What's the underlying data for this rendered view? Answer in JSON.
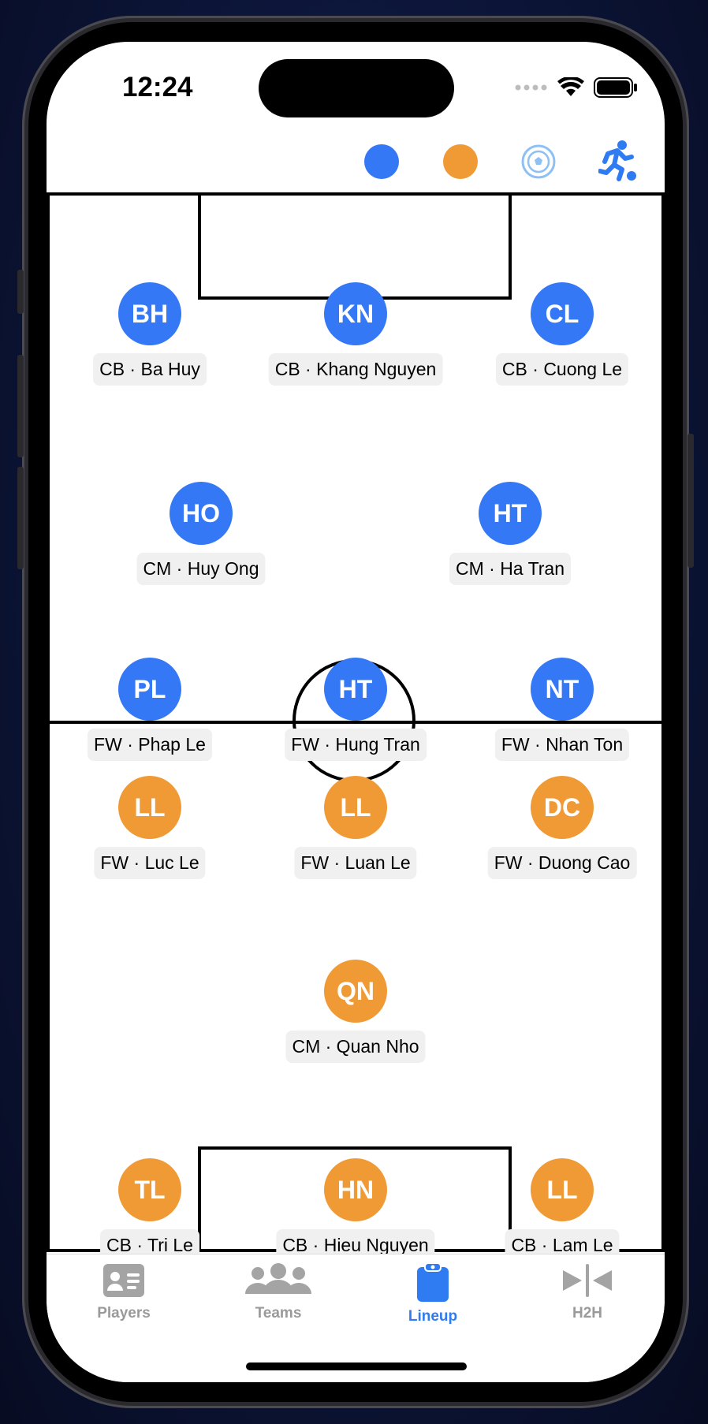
{
  "status": {
    "time": "12:24"
  },
  "toolbar": {
    "team_a_color": "#3478f6",
    "team_b_color": "#f09a36",
    "icons": [
      "team-a-dot",
      "team-b-dot",
      "soccer-ball-icon",
      "running-player-icon"
    ]
  },
  "colors": {
    "team_a": "#3478f6",
    "team_b": "#f09a36",
    "accent": "#2f7bf2"
  },
  "team_a": {
    "defenders": [
      {
        "initials": "BH",
        "label": "CB · Ba Huy"
      },
      {
        "initials": "KN",
        "label": "CB · Khang Nguyen"
      },
      {
        "initials": "CL",
        "label": "CB · Cuong Le"
      }
    ],
    "midfielders": [
      {
        "initials": "HO",
        "label": "CM · Huy Ong"
      },
      {
        "initials": "HT",
        "label": "CM · Ha Tran"
      }
    ],
    "forwards": [
      {
        "initials": "PL",
        "label": "FW · Phap Le"
      },
      {
        "initials": "HT",
        "label": "FW · Hung Tran"
      },
      {
        "initials": "NT",
        "label": "FW · Nhan Ton"
      }
    ]
  },
  "team_b": {
    "forwards": [
      {
        "initials": "LL",
        "label": "FW · Luc Le"
      },
      {
        "initials": "LL",
        "label": "FW · Luan Le"
      },
      {
        "initials": "DC",
        "label": "FW · Duong Cao"
      }
    ],
    "midfielders": [
      {
        "initials": "QN",
        "label": "CM · Quan Nho"
      }
    ],
    "defenders": [
      {
        "initials": "TL",
        "label": "CB · Tri Le"
      },
      {
        "initials": "HN",
        "label": "CB · Hieu Nguyen"
      },
      {
        "initials": "LL",
        "label": "CB · Lam Le"
      }
    ]
  },
  "tabs": [
    {
      "label": "Players",
      "icon": "person-card-icon",
      "active": false
    },
    {
      "label": "Teams",
      "icon": "people-group-icon",
      "active": false
    },
    {
      "label": "Lineup",
      "icon": "clipboard-icon",
      "active": true
    },
    {
      "label": "H2H",
      "icon": "head-to-head-icon",
      "active": false
    }
  ]
}
